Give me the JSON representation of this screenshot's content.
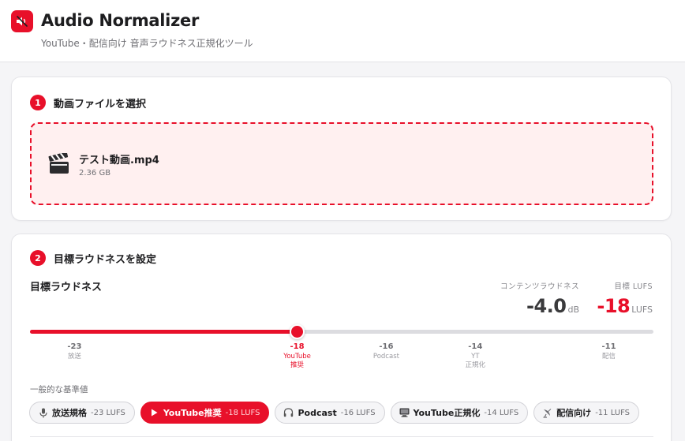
{
  "header": {
    "title": "Audio Normalizer",
    "subtitle": "YouTube・配信向け 音声ラウドネス正規化ツール"
  },
  "step1": {
    "number": "1",
    "title": "動画ファイルを選択",
    "file": {
      "icon": "clapperboard-icon",
      "name": "テスト動画.mp4",
      "size": "2.36 GB"
    }
  },
  "step2": {
    "number": "2",
    "title": "目標ラウドネスを設定",
    "target_label": "目標ラウドネス",
    "content_loudness": {
      "label": "コンテンツラウドネス",
      "value": "-4.0",
      "unit": "dB"
    },
    "target_lufs": {
      "label": "目標 LUFS",
      "value": "-18",
      "unit": "LUFS"
    },
    "slider": {
      "min": -24,
      "max": -10,
      "value": -18
    },
    "ticks": [
      {
        "value": "-23",
        "label": "放送"
      },
      {
        "value": "-18",
        "label": "YouTube\n推奨"
      },
      {
        "value": "-16",
        "label": "Podcast"
      },
      {
        "value": "-14",
        "label": "YT\n正規化"
      },
      {
        "value": "-11",
        "label": "配信"
      }
    ],
    "presets_label": "一般的な基準値",
    "presets": [
      {
        "icon": "microphone-icon",
        "name": "放送規格",
        "value": "-23 LUFS"
      },
      {
        "icon": "play-icon",
        "name": "YouTube推奨",
        "value": "-18 LUFS"
      },
      {
        "icon": "headphones-icon",
        "name": "Podcast",
        "value": "-16 LUFS"
      },
      {
        "icon": "monitor-icon",
        "name": "YouTube正規化",
        "value": "-14 LUFS"
      },
      {
        "icon": "satellite-icon",
        "name": "配信向け",
        "value": "-11 LUFS"
      }
    ],
    "selected_preset": 1
  },
  "colors": {
    "accent": "#e8102a",
    "background": "#f5f5f7",
    "card": "#ffffff",
    "drop_zone": "#fff0f0"
  }
}
